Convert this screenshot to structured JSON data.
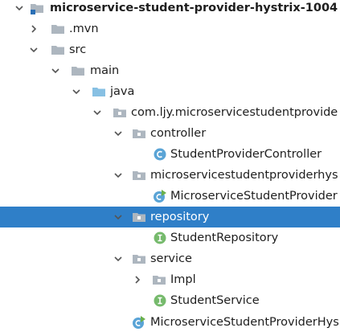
{
  "tree": {
    "items": [
      {
        "label": "microservice-student-provider-hystrix-1004",
        "icon": "module-folder-icon",
        "expanded": true,
        "bold": true
      },
      {
        "label": ".mvn",
        "icon": "folder-icon",
        "expanded": false
      },
      {
        "label": "src",
        "icon": "folder-icon",
        "expanded": true
      },
      {
        "label": "main",
        "icon": "folder-icon",
        "expanded": true
      },
      {
        "label": "java",
        "icon": "source-root-folder-icon",
        "expanded": true
      },
      {
        "label": "com.ljy.microservicestudentprovide",
        "icon": "package-icon",
        "expanded": true
      },
      {
        "label": "controller",
        "icon": "package-icon",
        "expanded": true
      },
      {
        "label": "StudentProviderController",
        "icon": "class-icon"
      },
      {
        "label": "microservicestudentproviderhys",
        "icon": "package-icon",
        "expanded": true
      },
      {
        "label": "MicroserviceStudentProvider",
        "icon": "spring-boot-class-icon"
      },
      {
        "label": "repository",
        "icon": "package-icon",
        "expanded": true,
        "selected": true
      },
      {
        "label": "StudentRepository",
        "icon": "interface-icon"
      },
      {
        "label": "service",
        "icon": "package-icon",
        "expanded": true
      },
      {
        "label": "Impl",
        "icon": "package-icon",
        "expanded": false
      },
      {
        "label": "StudentService",
        "icon": "interface-icon"
      },
      {
        "label": "MicroserviceStudentProviderHys",
        "icon": "spring-boot-class-icon"
      }
    ]
  },
  "colors": {
    "selection": "#2f7fc8",
    "folder": "#adb6bf",
    "source_root_folder": "#87c0e3",
    "class_icon": "#5aa4d6",
    "interface_icon": "#76ba6c",
    "spring_boot": "#6ab04c",
    "arrow": "#555555"
  }
}
